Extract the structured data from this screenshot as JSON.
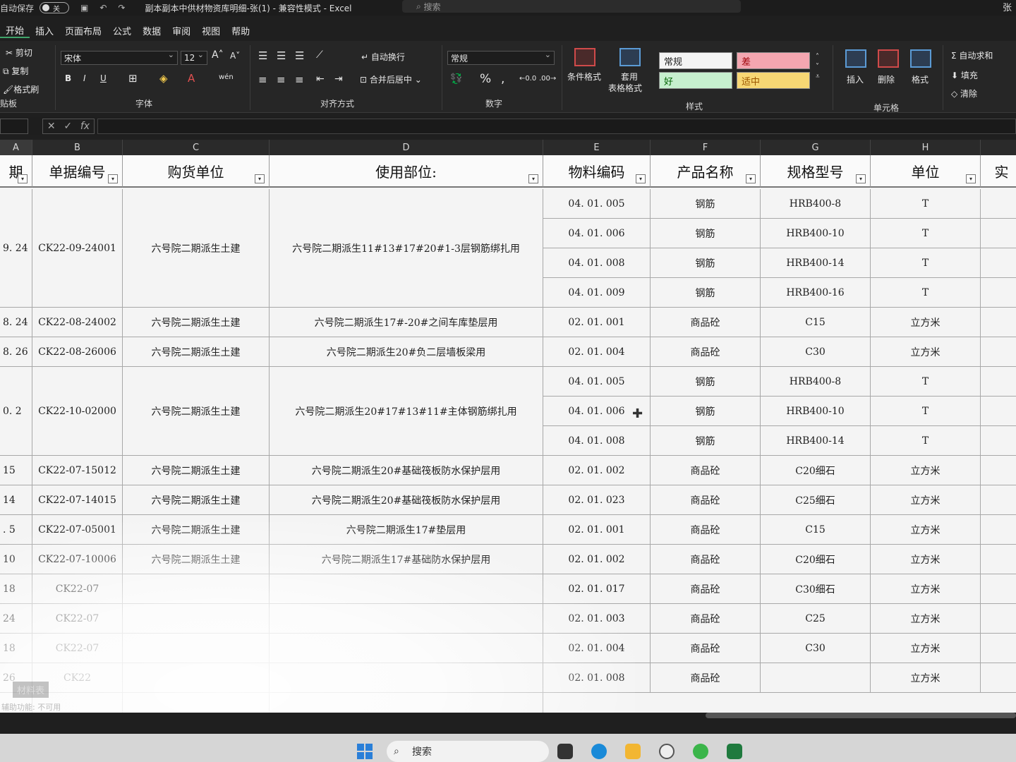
{
  "titlebar": {
    "autosave_label": "自动保存",
    "autosave_state": "关",
    "doc_title": "副本副本中供材物资库明细-张(1)  -  兼容性模式  -  Excel",
    "search_placeholder": "搜索",
    "user_initial": "张"
  },
  "ribbon_tabs": [
    "开始",
    "插入",
    "页面布局",
    "公式",
    "数据",
    "审阅",
    "视图",
    "帮助"
  ],
  "ribbon": {
    "clipboard": {
      "cut": "剪切",
      "copy": "复制",
      "format_painter": "格式刷",
      "label": "贴板"
    },
    "font": {
      "font_name": "宋体",
      "font_size": "12",
      "label": "字体"
    },
    "alignment": {
      "wrap_text": "自动换行",
      "merge_center": "合并后居中",
      "label": "对齐方式"
    },
    "number": {
      "format": "常规",
      "label": "数字"
    },
    "styles": {
      "conditional_formatting": "条件格式",
      "format_as_table_1": "套用",
      "format_as_table_2": "表格格式",
      "normal": "常规",
      "bad": "差",
      "good": "好",
      "neutral": "适中",
      "label": "样式"
    },
    "cells": {
      "insert": "插入",
      "delete": "删除",
      "format": "格式",
      "label": "单元格"
    },
    "editing": {
      "autosum": "自动求和",
      "fill": "填充",
      "clear": "清除"
    }
  },
  "formula_bar": {
    "fx_symbol": "fx"
  },
  "column_letters": [
    "A",
    "B",
    "C",
    "D",
    "E",
    "F",
    "G",
    "H"
  ],
  "table": {
    "headers": [
      "期",
      "单据编号",
      "购货单位",
      "使用部位:",
      "物料编码",
      "产品名称",
      "规格型号",
      "单位",
      "实"
    ],
    "groups": [
      {
        "date": "9. 24",
        "doc": "CK22-09-24001",
        "buyer": "六号院二期派生土建",
        "location": "六号院二期派生11#13#17#20#1-3层钢筋绑扎用"
      },
      {
        "date": "8. 24",
        "doc": "CK22-08-24002",
        "buyer": "六号院二期派生土建",
        "location": "六号院二期派生17#-20#之间车库垫层用"
      },
      {
        "date": "8. 26",
        "doc": "CK22-08-26006",
        "buyer": "六号院二期派生土建",
        "location": "六号院二期派生20#负二层墙板梁用"
      },
      {
        "date": "0. 2",
        "doc": "CK22-10-02000",
        "buyer": "六号院二期派生土建",
        "location": "六号院二期派生20#17#13#11#主体钢筋绑扎用"
      },
      {
        "date": "15",
        "doc": "CK22-07-15012",
        "buyer": "六号院二期派生土建",
        "location": "六号院二期派生20#基础筏板防水保护层用"
      },
      {
        "date": "14",
        "doc": "CK22-07-14015",
        "buyer": "六号院二期派生土建",
        "location": "六号院二期派生20#基础筏板防水保护层用"
      },
      {
        "date": ". 5",
        "doc": "CK22-07-05001",
        "buyer": "六号院二期派生土建",
        "location": "六号院二期派生17#垫层用"
      },
      {
        "date": "10",
        "doc": "CK22-07-10006",
        "buyer": "六号院二期派生土建",
        "location": "六号院二期派生17#基础防水保护层用"
      },
      {
        "date": "18",
        "doc": "CK22-07",
        "buyer": "",
        "location": ""
      },
      {
        "date": "24",
        "doc": "CK22-07",
        "buyer": "",
        "location": ""
      },
      {
        "date": "18",
        "doc": "CK22-07",
        "buyer": "",
        "location": ""
      },
      {
        "date": "26",
        "doc": "CK22",
        "buyer": "",
        "location": ""
      },
      {
        "date": "",
        "doc": "",
        "buyer": "",
        "location": ""
      }
    ],
    "rows": [
      {
        "code": "04. 01. 005",
        "name": "钢筋",
        "spec": "HRB400-8",
        "unit": "T"
      },
      {
        "code": "04. 01. 006",
        "name": "钢筋",
        "spec": "HRB400-10",
        "unit": "T"
      },
      {
        "code": "04. 01. 008",
        "name": "钢筋",
        "spec": "HRB400-14",
        "unit": "T"
      },
      {
        "code": "04. 01. 009",
        "name": "钢筋",
        "spec": "HRB400-16",
        "unit": "T"
      },
      {
        "code": "02. 01. 001",
        "name": "商品砼",
        "spec": "C15",
        "unit": "立方米"
      },
      {
        "code": "02. 01. 004",
        "name": "商品砼",
        "spec": "C30",
        "unit": "立方米"
      },
      {
        "code": "04. 01. 005",
        "name": "钢筋",
        "spec": "HRB400-8",
        "unit": "T"
      },
      {
        "code": "04. 01. 006",
        "name": "钢筋",
        "spec": "HRB400-10",
        "unit": "T"
      },
      {
        "code": "04. 01. 008",
        "name": "钢筋",
        "spec": "HRB400-14",
        "unit": "T"
      },
      {
        "code": "02. 01. 002",
        "name": "商品砼",
        "spec": "C20细石",
        "unit": "立方米"
      },
      {
        "code": "02. 01. 023",
        "name": "商品砼",
        "spec": "C25细石",
        "unit": "立方米"
      },
      {
        "code": "02. 01. 001",
        "name": "商品砼",
        "spec": "C15",
        "unit": "立方米"
      },
      {
        "code": "02. 01. 002",
        "name": "商品砼",
        "spec": "C20细石",
        "unit": "立方米"
      },
      {
        "code": "02. 01. 017",
        "name": "商品砼",
        "spec": "C30细石",
        "unit": "立方米"
      },
      {
        "code": "02. 01. 003",
        "name": "商品砼",
        "spec": "C25",
        "unit": "立方米"
      },
      {
        "code": "02. 01. 004",
        "name": "商品砼",
        "spec": "C30",
        "unit": "立方米"
      },
      {
        "code": "02. 01. 008",
        "name": "商品砼",
        "spec": "",
        "unit": "立方米"
      }
    ]
  },
  "sheet_tab": "材料表",
  "status_text": "辅助功能: 不可用",
  "taskbar": {
    "search_label": "搜索"
  },
  "colors": {
    "accent": "#3fa46a",
    "style_bad": "#f4a6b0",
    "style_good": "#c6efce",
    "style_neutral": "#f7d774"
  }
}
